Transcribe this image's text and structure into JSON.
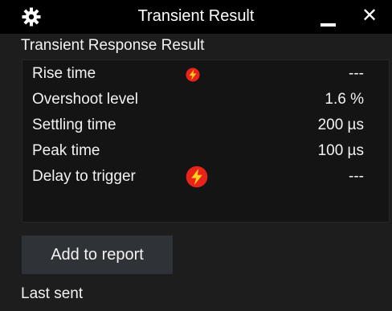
{
  "window": {
    "title": "Transient Result",
    "icons": {
      "settings": "gear-icon",
      "minimize": "minimize-icon",
      "close": "close-icon",
      "warning": "lightning-icon"
    },
    "close_glyph": "✕"
  },
  "section": {
    "title": "Transient Response Result"
  },
  "results": [
    {
      "label": "Rise time",
      "value": "---",
      "warning": true
    },
    {
      "label": "Overshoot level",
      "value": "1.6 %",
      "warning": false
    },
    {
      "label": "Settling time",
      "value": "200 µs",
      "warning": false
    },
    {
      "label": "Peak time",
      "value": "100 µs",
      "warning": false
    },
    {
      "label": "Delay to trigger",
      "value": "---",
      "warning": true
    }
  ],
  "actions": {
    "add_to_report": "Add to report"
  },
  "status": {
    "last_sent": "Last sent"
  },
  "colors": {
    "background": "#000000",
    "panel": "#1d1d1d",
    "results_box": "#141414",
    "button": "#2f3236",
    "warning_fill": "#e8231a",
    "warning_bolt": "#ffd21a",
    "text": "#f2f2f2"
  }
}
